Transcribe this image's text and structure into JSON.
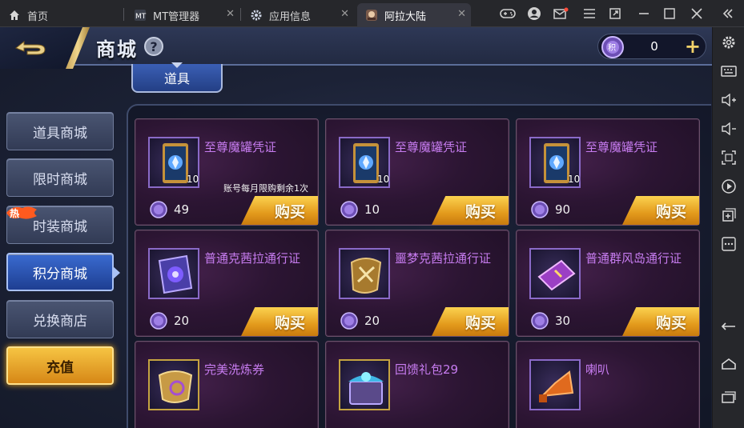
{
  "tabs": [
    {
      "label": "首页",
      "icon": "home-icon"
    },
    {
      "label": "MT管理器",
      "icon": "mt-app-icon"
    },
    {
      "label": "应用信息",
      "icon": "gear-icon"
    },
    {
      "label": "阿拉大陆",
      "icon": "game-app-icon",
      "active": true
    }
  ],
  "header": {
    "title": "商城",
    "help": "?",
    "currency_value": "0",
    "currency_plus": "+"
  },
  "category_tab": "道具",
  "nav": {
    "items": [
      "道具商城",
      "限时商城",
      "时装商城",
      "积分商城",
      "兑换商店"
    ],
    "selected": "积分商城",
    "hot_badge": "热",
    "recharge": "充值"
  },
  "products": [
    {
      "name": "至尊魔罐凭证",
      "qty": "10",
      "limit": "账号每月限购剩余1次",
      "price": "49",
      "buy": "购买",
      "icon": "card-voucher-icon"
    },
    {
      "name": "至尊魔罐凭证",
      "qty": "10",
      "limit": "",
      "price": "10",
      "buy": "购买",
      "icon": "card-voucher-icon"
    },
    {
      "name": "至尊魔罐凭证",
      "qty": "10",
      "limit": "",
      "price": "90",
      "buy": "购买",
      "icon": "card-voucher-icon"
    },
    {
      "name": "普通克茜拉通行证",
      "qty": "",
      "limit": "",
      "price": "20",
      "buy": "购买",
      "icon": "magic-scroll-icon"
    },
    {
      "name": "噩梦克茜拉通行证",
      "qty": "",
      "limit": "",
      "price": "20",
      "buy": "购买",
      "icon": "golden-scroll-icon"
    },
    {
      "name": "普通群风岛通行证",
      "qty": "",
      "limit": "",
      "price": "30",
      "buy": "购买",
      "icon": "purple-ticket-icon"
    },
    {
      "name": "完美洗炼券",
      "qty": "",
      "limit": "",
      "price": "",
      "buy": "",
      "icon": "refine-scroll-icon"
    },
    {
      "name": "回馈礼包29",
      "qty": "",
      "limit": "",
      "price": "",
      "buy": "",
      "icon": "gift-chest-icon"
    },
    {
      "name": "喇叭",
      "qty": "",
      "limit": "",
      "price": "",
      "buy": "",
      "icon": "horn-icon"
    }
  ],
  "colors": {
    "item_name": "#c77cf0",
    "buy_button": "#e39a1c",
    "selected_nav": "#1e3f92",
    "accent_gold": "#f3d26a"
  }
}
